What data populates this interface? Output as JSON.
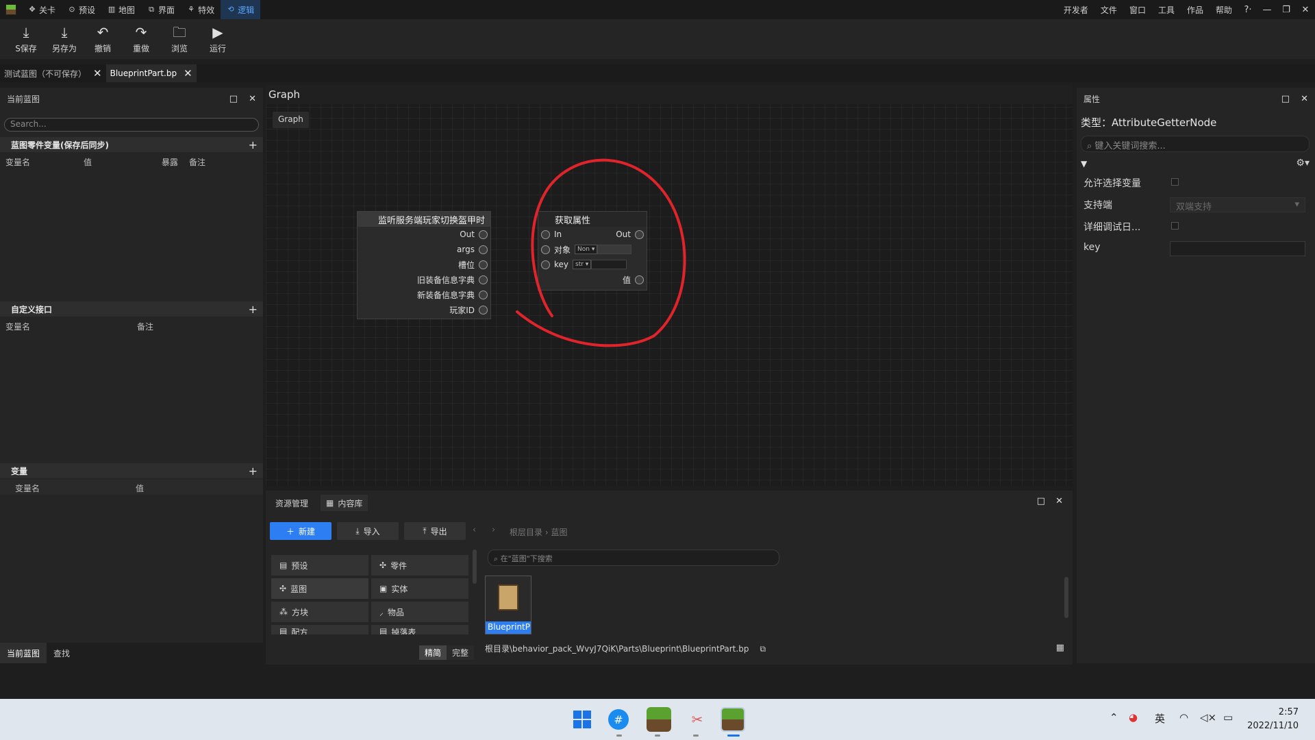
{
  "top_menu": {
    "items": [
      {
        "label": "关卡",
        "icon": "level-icon"
      },
      {
        "label": "预设",
        "icon": "preset-icon"
      },
      {
        "label": "地图",
        "icon": "map-icon"
      },
      {
        "label": "界面",
        "icon": "ui-icon"
      },
      {
        "label": "特效",
        "icon": "effects-icon"
      },
      {
        "label": "逻辑",
        "icon": "logic-icon",
        "active": true
      }
    ],
    "right_items": [
      "开发者",
      "文件",
      "窗口",
      "工具",
      "作品",
      "帮助"
    ]
  },
  "toolbar": {
    "save": "S保存",
    "save_as": "另存为",
    "undo": "撤销",
    "redo": "重做",
    "browse": "浏览",
    "run": "运行"
  },
  "doc_tabs": [
    {
      "label": "测试蓝图（不可保存）",
      "active": false
    },
    {
      "label": "BlueprintPart.bp",
      "active": true
    }
  ],
  "left_panel": {
    "title": "当前蓝图",
    "search_placeholder": "Search...",
    "sec1": {
      "title": "蓝图零件变量(保存后同步)",
      "cols": [
        "变量名",
        "值",
        "暴露",
        "备注"
      ]
    },
    "sec2": {
      "title": "自定义接口",
      "cols": [
        "变量名",
        "备注"
      ]
    },
    "sec3": {
      "title": "变量",
      "cols": [
        "变量名",
        "值"
      ]
    },
    "bottom_tabs": [
      "当前蓝图",
      "查找"
    ]
  },
  "graph": {
    "title": "Graph",
    "breadcrumb": "Graph",
    "event_node": {
      "title": "监听服务端玩家切换盔甲时",
      "pins": [
        "Out",
        "args",
        "槽位",
        "旧装备信息字典",
        "新装备信息字典",
        "玩家ID"
      ]
    },
    "getter_node": {
      "title": "获取属性",
      "in_label": "In",
      "out_label": "Out",
      "target_label": "对象",
      "target_select": "Non",
      "key_label": "key",
      "key_select": "str",
      "value_label": "值"
    }
  },
  "right_panel": {
    "title": "属性",
    "type_text": "类型：AttributeGetterNode",
    "search_placeholder": "键入关键词搜索...",
    "props": {
      "allow_select_var": "允许选择变量",
      "support_side": "支持端",
      "support_side_value": "双端支持",
      "verbose_debug": "详细调试日...",
      "key": "key"
    }
  },
  "bottom_panel": {
    "tabs": [
      "资源管理",
      "内容库"
    ],
    "new_btn": "新建",
    "import_btn": "导入",
    "export_btn": "导出",
    "crumb_root": "根层目录",
    "crumb_current": "蓝图",
    "search_placeholder": "在\"蓝图\"下搜索",
    "categories": [
      {
        "label": "预设",
        "icon": "preset-icon"
      },
      {
        "label": "零件",
        "icon": "part-icon"
      },
      {
        "label": "蓝图",
        "icon": "blueprint-icon",
        "active": true
      },
      {
        "label": "实体",
        "icon": "entity-icon"
      },
      {
        "label": "方块",
        "icon": "block-icon"
      },
      {
        "label": "物品",
        "icon": "item-icon"
      },
      {
        "label": "配方",
        "icon": "recipe-icon"
      },
      {
        "label": "掉落表",
        "icon": "loot-icon"
      }
    ],
    "view_modes": [
      "精简",
      "完整"
    ],
    "asset_label": "BlueprintP",
    "path": "根目录\\behavior_pack_WvyJ7QiK\\Parts\\Blueprint\\BlueprintPart.bp"
  },
  "taskbar": {
    "ime": "英",
    "time": "2:57",
    "date": "2022/11/10"
  },
  "colors": {
    "accent": "#2c7ef2",
    "annotation_circle": "#e0242b",
    "active_tab_text": "#5aa7ff"
  }
}
